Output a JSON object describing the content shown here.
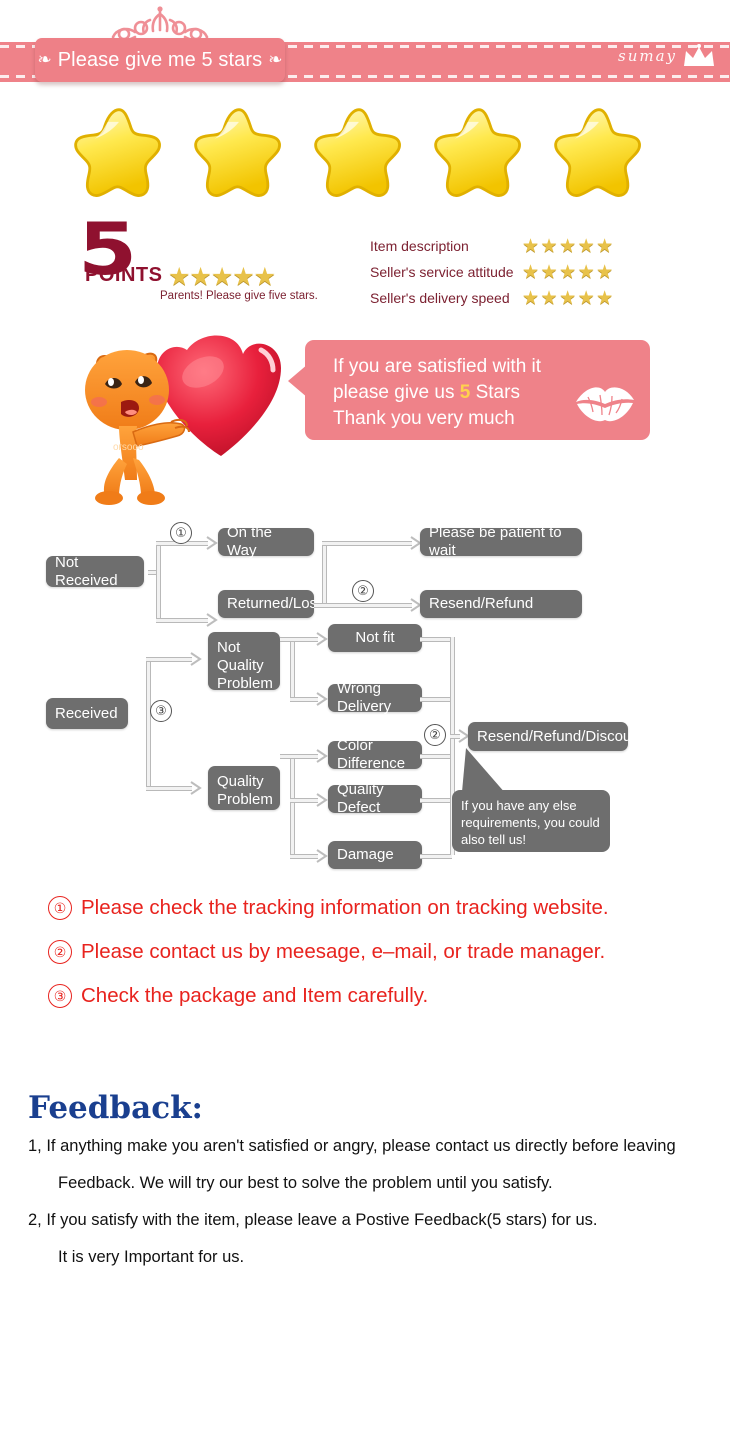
{
  "banner": {
    "title": "Please give me 5 stars",
    "ornament_left": "❧",
    "ornament_right": "❧",
    "brand": "sumay",
    "brand_icon": "crown-icon",
    "tiara_icon": "tiara-icon",
    "pink": "#ef8289"
  },
  "big_stars": {
    "count": 5,
    "icon": "star-icon",
    "color": "#f5d423"
  },
  "points": {
    "number": "5",
    "word": "POINTS",
    "stars": "★★★★★",
    "note": "Parents! Please give five stars.",
    "color": "#8f112f"
  },
  "ratings": [
    {
      "label": "Item description",
      "stars": "★★★★★",
      "value": 5
    },
    {
      "label": "Seller's service attitude",
      "stars": "★★★★★",
      "value": 5
    },
    {
      "label": "Seller's delivery speed",
      "stars": "★★★★★",
      "value": 5
    }
  ],
  "bubble": {
    "line1": "If you are satisfied with it",
    "line2_pre": "please give us ",
    "line2_hl": "5",
    "line2_post": " Stars",
    "line3": "Thank you very much",
    "lips_icon": "lips-icon",
    "mascot_icon": "mascot-heart-icon"
  },
  "flowchart": {
    "nodes": {
      "not_received": "Not Received",
      "on_the_way": "On the Way",
      "returned_lost": "Returned/Lost",
      "be_patient": "Please be patient to wait",
      "resend_refund": "Resend/Refund",
      "received": "Received",
      "not_quality_problem": "Not\nQuality\nProblem",
      "not_fit": "Not fit",
      "wrong_delivery": "Wrong Delivery",
      "quality_problem": "Quality\nProblem",
      "color_difference": "Color Difference",
      "quality_defect": "Quality Defect",
      "damage": "Damage",
      "resend_refund_discount": "Resend/Refund/Discount"
    },
    "markers": {
      "one": "①",
      "two": "②",
      "three": "③"
    },
    "callout": "If you have any else requirements, you could also tell us!",
    "box_color": "#6e6e6e"
  },
  "red_notes": [
    {
      "num": "①",
      "text": "Please check the tracking information on tracking website."
    },
    {
      "num": "②",
      "text": "Please contact us by meesage, e–mail, or trade manager."
    },
    {
      "num": "③",
      "text": "Check the package and Item carefully."
    }
  ],
  "feedback": {
    "title": "Feedback:",
    "lines": [
      "1, If anything make you aren't satisfied or angry, please contact us directly before leaving",
      "Feedback. We will try our best to solve the problem until you satisfy.",
      "2, If you satisfy with the item, please leave a Postive Feedback(5 stars) for us.",
      "It is very Important for us."
    ]
  },
  "colors": {
    "red": "#e8231e",
    "blue": "#1a3f8f",
    "maroon": "#8f112f",
    "gold": "#e8c24a"
  }
}
